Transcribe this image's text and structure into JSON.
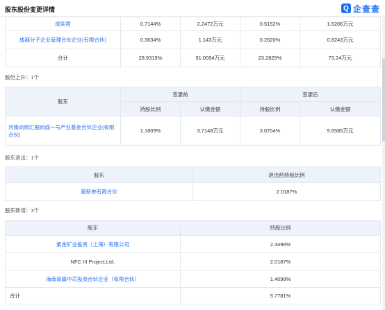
{
  "header": {
    "title": "股东股份变更详情",
    "brand": "企查查"
  },
  "top_table": {
    "rows": [
      {
        "name": "成奕君",
        "before_ratio": "0.7144%",
        "before_amount": "2.2472万元",
        "after_ratio": "0.5152%",
        "after_amount": "1.6206万元"
      },
      {
        "name": "成都分子企业管理合伙企业(有限合伙)",
        "before_ratio": "0.3634%",
        "before_amount": "1.143万元",
        "after_ratio": "0.2620%",
        "after_amount": "0.8243万元"
      }
    ],
    "total": {
      "label": "合计",
      "before_ratio": "28.9319%",
      "before_amount": "91.0094万元",
      "after_ratio": "23.2829%",
      "after_amount": "73.24万元"
    }
  },
  "rise": {
    "label": "股份上升：1个",
    "headers": {
      "holder": "股东",
      "before": "变更前",
      "after": "变更后",
      "ratio": "持股比例",
      "amount": "认缴金额"
    },
    "rows": [
      {
        "name": "河南尚颀汇融尚成一号产业基金合伙企业(有限合伙)",
        "before_ratio": "1.1809%",
        "before_amount": "3.7148万元",
        "after_ratio": "3.0704%",
        "after_amount": "9.6585万元"
      }
    ]
  },
  "exit": {
    "label": "股东退出：1个",
    "headers": {
      "holder": "股东",
      "ratio": "退出前持股比例"
    },
    "rows": [
      {
        "name": "曼新参有限合伙",
        "ratio": "2.0187%"
      }
    ]
  },
  "new": {
    "label": "股东新增：3个",
    "headers": {
      "holder": "股东",
      "ratio": "持股比例"
    },
    "rows": [
      {
        "name": "紫金矿业投资（上海）有限公司",
        "ratio": "2.3496%",
        "link": true
      },
      {
        "name": "NFC III Project,Ltd.",
        "ratio": "2.0187%",
        "link": false
      },
      {
        "name": "海南道篇中芯投资合伙企业（有限合伙）",
        "ratio": "1.4098%",
        "link": true
      }
    ],
    "total": {
      "label": "合计",
      "ratio": "5.7781%"
    }
  }
}
